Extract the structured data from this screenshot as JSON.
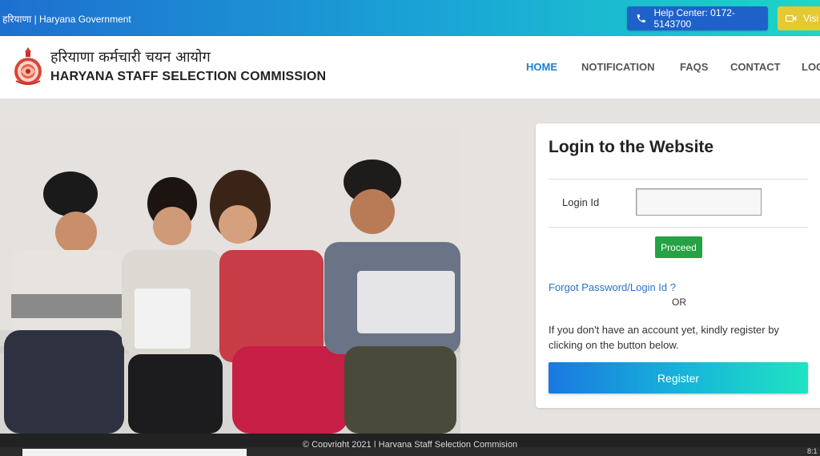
{
  "topbar": {
    "gov_text": "हरियाणा | Haryana Government",
    "help_label": "Help Center: 0172-5143700",
    "visit_label": "Visi"
  },
  "header": {
    "hindi_title": "हरियाणा कर्मचारी चयन आयोग",
    "english_title": "HARYANA STAFF SELECTION COMMISSION",
    "nav": [
      {
        "label": "HOME",
        "active": true
      },
      {
        "label": "NOTIFICATION",
        "active": false
      },
      {
        "label": "FAQS",
        "active": false
      },
      {
        "label": "CONTACT",
        "active": false
      },
      {
        "label": "LOG",
        "active": false
      }
    ]
  },
  "login": {
    "title": "Login to the Website",
    "login_id_label": "Login Id",
    "login_id_value": "",
    "proceed_label": "Proceed",
    "forgot_label": "Forgot Password/Login Id ?",
    "or_label": "OR",
    "register_info": "If you don't have an account yet, kindly register by clicking on the button below.",
    "register_label": "Register"
  },
  "footer": {
    "copyright": "© Copyright 2021 | Haryana Staff Selection Commision"
  },
  "taskbar": {
    "clock": "8:1"
  },
  "colors": {
    "accent": "#1e7fd0",
    "proceed": "#25a244",
    "topbar_start": "#1e6fd0",
    "topbar_end": "#1dd6c8"
  }
}
